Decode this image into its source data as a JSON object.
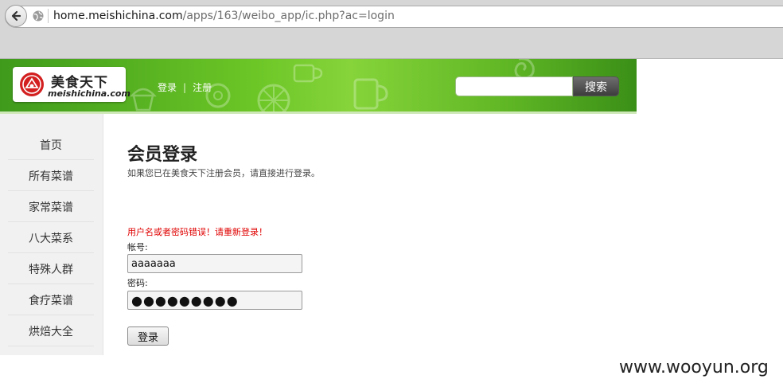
{
  "browser": {
    "url_host": "home.meishichina.com",
    "url_path": "/apps/163/weibo_app/ic.php?ac=login"
  },
  "header": {
    "logo_cn": "美食天下",
    "logo_en": "meishichina.com",
    "login_link": "登录",
    "separator": "|",
    "register_link": "注册",
    "search_value": "",
    "search_button": "搜索"
  },
  "sidebar": {
    "items": [
      {
        "label": "首页"
      },
      {
        "label": "所有菜谱"
      },
      {
        "label": "家常菜谱"
      },
      {
        "label": "八大菜系"
      },
      {
        "label": "特殊人群"
      },
      {
        "label": "食疗菜谱"
      },
      {
        "label": "烘焙大全"
      }
    ]
  },
  "main": {
    "title": "会员登录",
    "subtitle": "如果您已在美食天下注册会员，请直接进行登录。",
    "error": "用户名或者密码错误！请重新登录！",
    "account_label": "帐号:",
    "account_value": "aaaaaaa",
    "password_label": "密码:",
    "password_value": "●●●●●●●●●",
    "login_button": "登录"
  },
  "watermark": "www.wooyun.org",
  "colors": {
    "header_green": "#6cc626",
    "error_red": "#e00000",
    "sidebar_bg": "#f1f1f1"
  }
}
